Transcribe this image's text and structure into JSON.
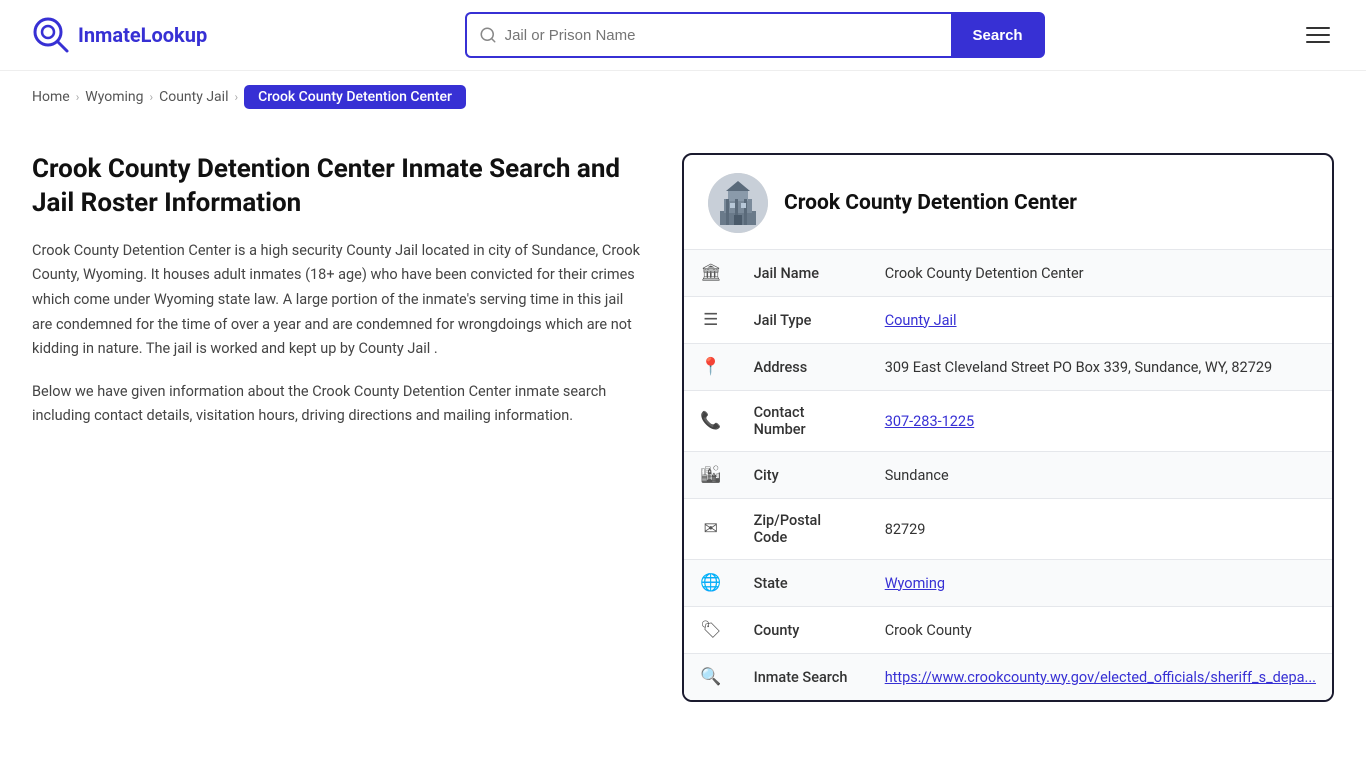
{
  "header": {
    "logo_text": "InmateLookup",
    "search_placeholder": "Jail or Prison Name",
    "search_button_label": "Search"
  },
  "breadcrumb": {
    "home": "Home",
    "state": "Wyoming",
    "type": "County Jail",
    "current": "Crook County Detention Center"
  },
  "left": {
    "title": "Crook County Detention Center Inmate Search and Jail Roster Information",
    "desc1": "Crook County Detention Center is a high security County Jail located in city of Sundance, Crook County, Wyoming. It houses adult inmates (18+ age) who have been convicted for their crimes which come under Wyoming state law. A large portion of the inmate's serving time in this jail are condemned for the time of over a year and are condemned for wrongdoings which are not kidding in nature. The jail is worked and kept up by County Jail .",
    "desc2": "Below we have given information about the Crook County Detention Center inmate search including contact details, visitation hours, driving directions and mailing information."
  },
  "card": {
    "title": "Crook County Detention Center",
    "rows": [
      {
        "icon": "🏛",
        "label": "Jail Name",
        "value": "Crook County Detention Center",
        "link": null
      },
      {
        "icon": "☰",
        "label": "Jail Type",
        "value": "County Jail",
        "link": "#"
      },
      {
        "icon": "📍",
        "label": "Address",
        "value": "309 East Cleveland Street PO Box 339, Sundance, WY, 82729",
        "link": null
      },
      {
        "icon": "📞",
        "label": "Contact Number",
        "value": "307-283-1225",
        "link": "tel:307-283-1225"
      },
      {
        "icon": "🏙",
        "label": "City",
        "value": "Sundance",
        "link": null
      },
      {
        "icon": "✉",
        "label": "Zip/Postal Code",
        "value": "82729",
        "link": null
      },
      {
        "icon": "🌐",
        "label": "State",
        "value": "Wyoming",
        "link": "#"
      },
      {
        "icon": "🏷",
        "label": "County",
        "value": "Crook County",
        "link": null
      },
      {
        "icon": "🔍",
        "label": "Inmate Search",
        "value": "https://www.crookcounty.wy.gov/elected_officials/sheriff_s_depa...",
        "link": "https://www.crookcounty.wy.gov/elected_officials/sheriff_s_depa"
      }
    ]
  }
}
